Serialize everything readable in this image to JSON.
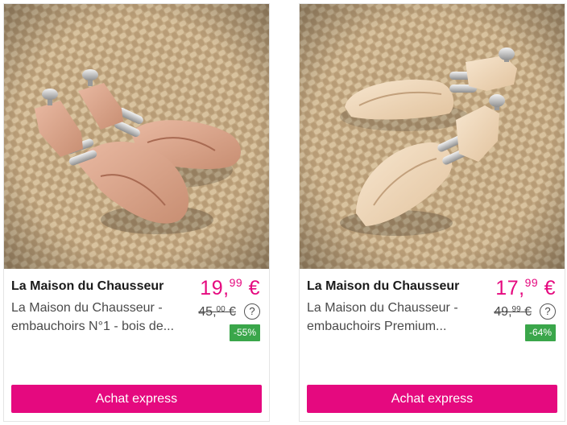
{
  "products": [
    {
      "brand": "La Maison du Chausseur",
      "title_line1": "La Maison du Chausseur -",
      "title_line2": "embauchoirs N°1 - bois de...",
      "price_main": "19,",
      "price_cents": "99",
      "price_currency": " €",
      "old_price_main": "45,",
      "old_price_cents": "00",
      "old_price_currency": " €",
      "help_icon": "?",
      "discount": "-55%",
      "button_label": "Achat express",
      "image_icon": "cedar-shoe-trees-photo"
    },
    {
      "brand": "La Maison du Chausseur",
      "title_line1": "La Maison du Chausseur -",
      "title_line2": "embauchoirs Premium...",
      "price_main": "17,",
      "price_cents": "99",
      "price_currency": " €",
      "old_price_main": "49,",
      "old_price_cents": "99",
      "old_price_currency": " €",
      "help_icon": "?",
      "discount": "-64%",
      "button_label": "Achat express",
      "image_icon": "premium-shoe-trees-photo"
    }
  ],
  "colors": {
    "accent_pink": "#e5097f",
    "discount_green": "#3aa64a",
    "wood_cedar": "#d9a68c",
    "wood_light": "#f0d7b8",
    "jute_background": "#c9b08a"
  }
}
